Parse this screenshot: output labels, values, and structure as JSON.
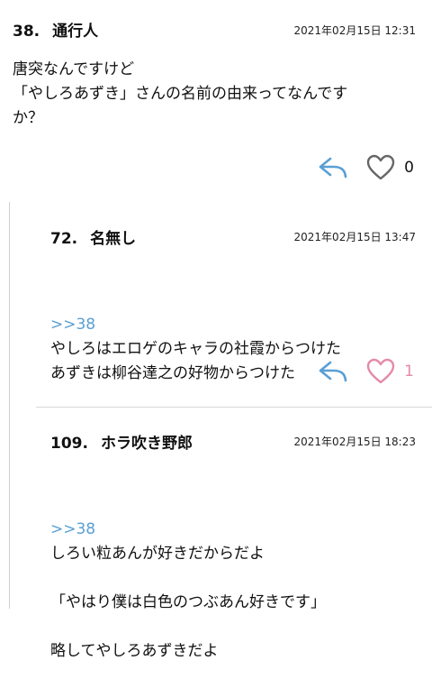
{
  "comments": [
    {
      "number": "38.",
      "author": "通行人",
      "date": "2021年02月15日 12:31",
      "anchor": "",
      "body": "唐突なんですけど\n「やしろあずき」さんの名前の由来ってなんです\nか？",
      "likes": "0",
      "liked": false
    },
    {
      "number": "72.",
      "author": "名無し",
      "date": "2021年02月15日 13:47",
      "anchor": ">>38",
      "body": "やしろはエロゲのキャラの社霞からつけた\nあずきは柳谷達之の好物からつけた",
      "likes": "1",
      "liked": true
    },
    {
      "number": "109.",
      "author": "ホラ吹き野郎",
      "date": "2021年02月15日 18:23",
      "anchor": ">>38",
      "body": "しろい粒あんが好きだからだよ\n\n「やはり僕は白色のつぶあん好きです」\n\n略してやしろあずきだよ",
      "likes": "",
      "liked": false
    }
  ],
  "colors": {
    "reply_icon": "#5a9fd4",
    "heart_unliked": "#666666",
    "heart_liked": "#e48aa8",
    "anchor": "#5a9fd4"
  },
  "icons": {
    "reply": "reply-arrow-icon",
    "like": "heart-icon"
  }
}
